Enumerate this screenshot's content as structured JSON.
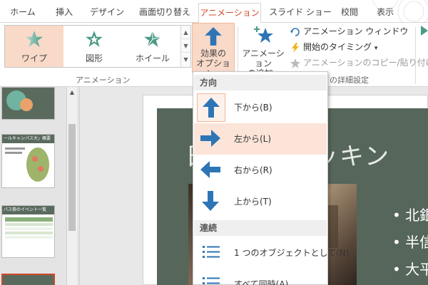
{
  "tabs": [
    {
      "label": "ホーム"
    },
    {
      "label": "挿入"
    },
    {
      "label": "デザイン"
    },
    {
      "label": "画面切り替え"
    },
    {
      "label": "アニメーション"
    },
    {
      "label": "スライド ショー"
    },
    {
      "label": "校閲"
    },
    {
      "label": "表示"
    }
  ],
  "ribbon": {
    "gallery": [
      {
        "label": "ワイプ",
        "selected": true,
        "icon": "star-wipe-icon"
      },
      {
        "label": "図形",
        "selected": false,
        "icon": "star-shape-icon"
      },
      {
        "label": "ホイール",
        "selected": false,
        "icon": "star-wheel-icon"
      }
    ],
    "group_animation_label": "アニメーション",
    "effect_options": {
      "line1": "効果の",
      "line2": "オプション",
      "caret": "▾"
    },
    "add_animation": {
      "line1": "アニメーション",
      "line2": "の追加",
      "caret": "▾"
    },
    "animation_pane": "アニメーション ウィンドウ",
    "start_timing": "開始のタイミング",
    "start_timing_caret": "▾",
    "animation_painter": "アニメーションのコピー/貼り付け",
    "group_advanced_label_visible": "の詳細設定"
  },
  "dropdown": {
    "direction_header": "方向",
    "directions": [
      {
        "label": "下から(B)",
        "icon": "arrow-up-icon"
      },
      {
        "label": "左から(L)",
        "icon": "arrow-right-icon"
      },
      {
        "label": "右から(R)",
        "icon": "arrow-left-icon"
      },
      {
        "label": "上から(T)",
        "icon": "arrow-down-icon"
      }
    ],
    "sequence_header": "連続",
    "sequences": [
      {
        "label": "1 つのオブジェクトとして(N)",
        "icon": "list-bullets-icon"
      },
      {
        "label": "すべて同時(A)",
        "icon": "list-bullets-icon"
      }
    ]
  },
  "slide": {
    "title_visible": "日　　トレッキン",
    "bullets": [
      "• 北銀",
      "• 半信",
      "• 大平"
    ]
  },
  "thumbnails": {
    "thumb2_title": "ールキャンパス大」概要",
    "thumb3_title": "パス祭のイベント一覧"
  },
  "colors": {
    "accent": "#d24726",
    "selected_fill": "#f9d9c8",
    "icon_blue": "#2e75b6",
    "star_teal": "#4a9a86",
    "slide_bg": "#56665a"
  }
}
